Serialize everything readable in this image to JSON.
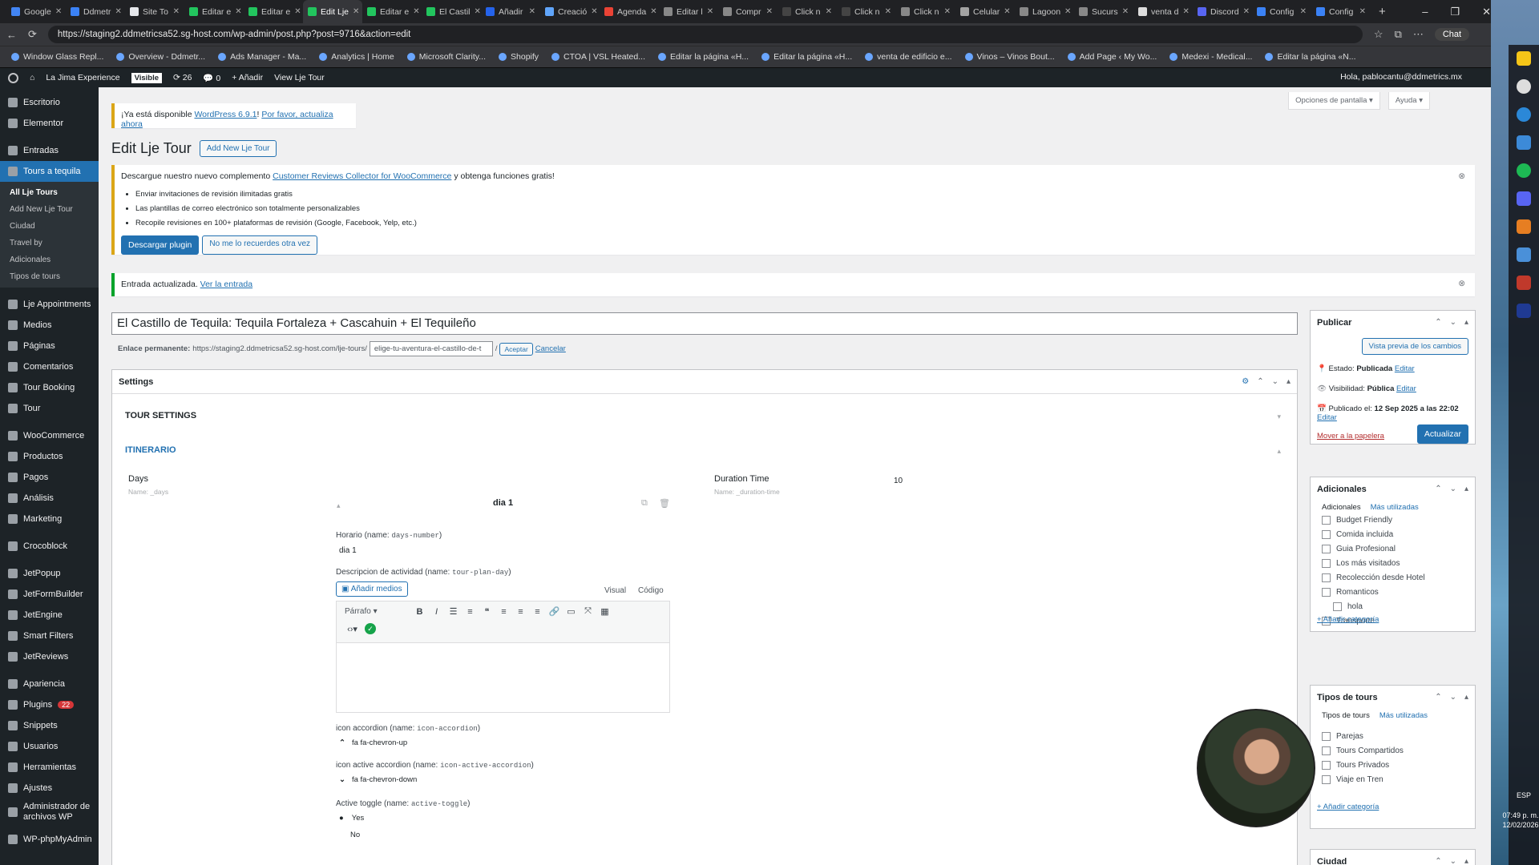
{
  "browser": {
    "tabs": [
      "Google",
      "Ddmetr",
      "Site To",
      "Editar e",
      "Editar e",
      "Edit Lje",
      "Editar e",
      "El Castil",
      "Añadir",
      "Creació",
      "Agenda",
      "Editar l",
      "Compr",
      "Click n",
      "Click n",
      "Click n",
      "Celular",
      "Lagoon",
      "Sucurs",
      "venta d",
      "Discord",
      "Config",
      "Config"
    ],
    "url": "https://staging2.ddmetricsa52.sg-host.com/wp-admin/post.php?post=9716&action=edit",
    "chat": "Chat",
    "bookmarks": [
      "Window Glass Repl...",
      "Overview - Ddmetr...",
      "Ads Manager - Ma...",
      "Analytics | Home",
      "Microsoft Clarity...",
      "Shopify",
      "CTOA | VSL Heated...",
      "Editar la página «H...",
      "Editar la página «H...",
      "venta de edificio e...",
      "Vinos – Vinos Bout...",
      "Add Page ‹ My Wo...",
      "Medexi - Medical...",
      "Editar la página «N..."
    ]
  },
  "adminbar": {
    "site": "La Jima Experience",
    "visible": "Visible",
    "updates": "26",
    "comments": "0",
    "add": "Añadir",
    "view": "View Lje Tour",
    "howdy": "Hola, pablocantu@ddmetrics.mx"
  },
  "sidebar": {
    "items": [
      "Escritorio",
      "Elementor",
      "Entradas",
      "Tours a tequila"
    ],
    "sub": [
      "All Lje Tours",
      "Add New Lje Tour",
      "Ciudad",
      "Travel by",
      "Adicionales",
      "Tipos de tours"
    ],
    "items2": [
      "Lje Appointments",
      "Medios",
      "Páginas",
      "Comentarios",
      "Tour Booking",
      "Tour"
    ],
    "items3": [
      "WooCommerce",
      "Productos",
      "Pagos",
      "Análisis",
      "Marketing"
    ],
    "items4": [
      "Crocoblock"
    ],
    "items5": [
      "JetPopup",
      "JetFormBuilder",
      "JetEngine",
      "Smart Filters",
      "JetReviews"
    ],
    "items6": [
      "Apariencia",
      "Plugins",
      "Snippets",
      "Usuarios",
      "Herramientas",
      "Ajustes",
      "Administrador de archivos WP",
      "WP-phpMyAdmin"
    ],
    "plugins_badge": "22"
  },
  "page": {
    "screen_options": "Opciones de pantalla",
    "help": "Ayuda",
    "update_notice_pre": "¡Ya está disponible ",
    "update_link1": "WordPress 6.9.1",
    "update_notice_mid": "! ",
    "update_link2": "Por favor, actualiza ahora",
    "title": "Edit Lje Tour",
    "add_new": "Add New Lje Tour",
    "promo_pre": "Descargue nuestro nuevo complemento ",
    "promo_link": "Customer Reviews Collector for WooCommerce",
    "promo_post": " y obtenga funciones gratis!",
    "promo_bullets": [
      "Enviar invitaciones de revisión ilimitadas gratis",
      "Las plantillas de correo electrónico son totalmente personalizables",
      "Recopile revisiones en 100+ plataformas de revisión (Google, Facebook, Yelp, etc.)"
    ],
    "promo_btn1": "Descargar plugin",
    "promo_btn2": "No me lo recuerdes otra vez",
    "updated": "Entrada actualizada. ",
    "updated_link": "Ver la entrada",
    "post_title": "El Castillo de Tequila: Tequila Fortaleza + Cascahuin + El Tequileño",
    "permalink_label": "Enlace permanente:",
    "permalink_base": "https://staging2.ddmetricsa52.sg-host.com/lje-tours/",
    "slug": "elige-tu-aventura-el-castillo-de-t",
    "accept": "Aceptar",
    "cancel": "Cancelar"
  },
  "settings": {
    "title": "Settings",
    "tour_settings": "TOUR SETTINGS",
    "itinerario": "ITINERARIO",
    "days_label": "Days",
    "days_name": "Name: _days",
    "duration_label": "Duration Time",
    "duration_name": "Name: _duration-time",
    "duration_value": "10",
    "dia_title": "dia 1",
    "horario_label": "Horario (name: ",
    "horario_code": "days-number",
    "horario_value": "dia 1",
    "desc_label": "Descripcion de actividad (name: ",
    "desc_code": "tour-plan-day",
    "add_media": "Añadir medios",
    "visual": "Visual",
    "codigo": "Código",
    "paragraph": "Párrafo",
    "icon_label": "icon accordion (name: ",
    "icon_code": "icon-accordion",
    "icon_value": "fa fa-chevron-up",
    "icon_active_label": "icon active accordion (name: ",
    "icon_active_code": "icon-active-accordion",
    "icon_active_value": "fa fa-chevron-down",
    "toggle_label": "Active toggle (name: ",
    "toggle_code": "active-toggle",
    "yes": "Yes",
    "no": "No",
    "close_paren": ")"
  },
  "publish": {
    "title": "Publicar",
    "preview": "Vista previa de los cambios",
    "estado_label": "Estado: ",
    "estado": "Publicada",
    "visibilidad_label": "Visibilidad: ",
    "visibilidad": "Pública",
    "publicado_label": "Publicado el: ",
    "publicado": "12 Sep 2025 a las 22:02",
    "editar": "Editar",
    "trash": "Mover a la papelera",
    "update": "Actualizar"
  },
  "adicionales": {
    "title": "Adicionales",
    "tab1": "Adicionales",
    "tab2": "Más utilizadas",
    "items": [
      "Budget Friendly",
      "Comida incluida",
      "Guia Profesional",
      "Los más visitados",
      "Recolección desde Hotel",
      "Romanticos"
    ],
    "child": "hola",
    "last": "Transporte",
    "add": "+ Añadir categoría"
  },
  "tipos": {
    "title": "Tipos de tours",
    "tab1": "Tipos de tours",
    "tab2": "Más utilizadas",
    "items": [
      "Parejas",
      "Tours Compartidos",
      "Tours Privados",
      "Viaje en Tren"
    ],
    "add": "+ Añadir categoría"
  },
  "ciudad": {
    "title": "Ciudad"
  },
  "taskbar": {
    "time": "07:49 p. m.",
    "date": "12/02/2026",
    "lang": "ESP"
  }
}
